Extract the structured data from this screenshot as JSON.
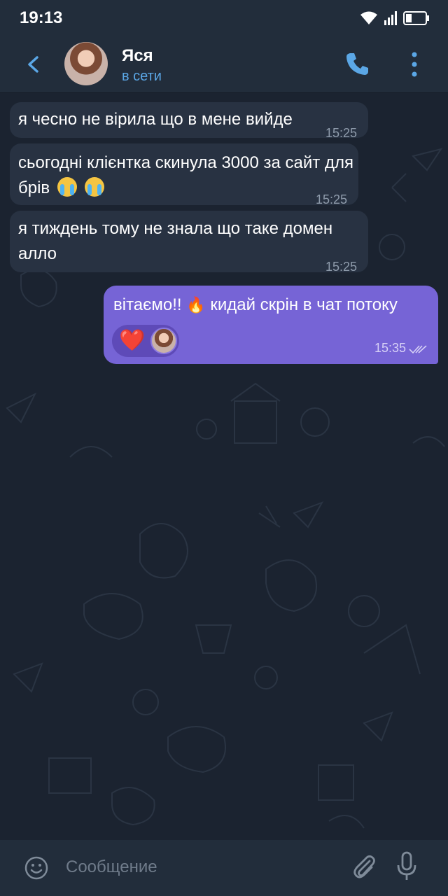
{
  "status_bar": {
    "time": "19:13"
  },
  "header": {
    "contact_name": "Яся",
    "contact_status": "в сети"
  },
  "messages": [
    {
      "direction": "in",
      "text": "я чесно не вірила що в мене вийде",
      "time": "15:25"
    },
    {
      "direction": "in",
      "text": "сьогодні клієнтка скинула 3000 за сайт для брів",
      "emoji": "😭😭",
      "time": "15:25"
    },
    {
      "direction": "in",
      "text": "я тиждень тому не знала що таке домен алло",
      "time": "15:25"
    },
    {
      "direction": "out",
      "text_before": "вітаємо!!",
      "emoji": "🔥",
      "text_after": "кидай скрін в чат потоку",
      "time": "15:35",
      "reaction": "❤️"
    }
  ],
  "input": {
    "placeholder": "Сообщение"
  },
  "colors": {
    "background": "#1b2330",
    "header": "#222d3b",
    "incoming_bubble": "#283242",
    "outgoing_bubble": "#7664d6",
    "accent": "#5ba7e6"
  },
  "icons": [
    "wifi-icon",
    "signal-icon",
    "battery-icon",
    "back-arrow-icon",
    "phone-icon",
    "more-vertical-icon",
    "emoji-icon",
    "attach-icon",
    "microphone-icon",
    "read-ticks-icon"
  ]
}
